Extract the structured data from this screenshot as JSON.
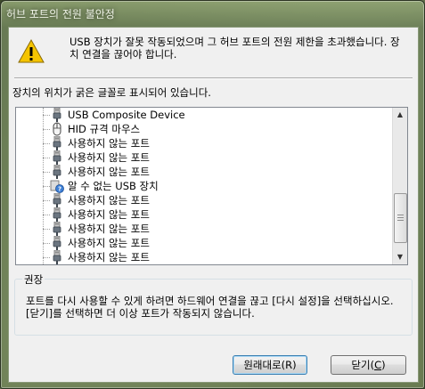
{
  "window": {
    "title": "허브 포트의 전원 불안정"
  },
  "message": {
    "icon": "warning-icon",
    "text": "USB 장치가 잘못 작동되었으며 그 허브 포트의 전원 제한을 초과했습니다. 장치 연결을 끊어야 합니다."
  },
  "location_label": "장치의 위치가 굵은 글꼴로 표시되어 있습니다.",
  "tree": {
    "items": [
      {
        "label": "USB Composite Device",
        "icon": "usb-plug-icon"
      },
      {
        "label": "HID 규격 마우스",
        "icon": "mouse-icon"
      },
      {
        "label": "사용하지 않는 포트",
        "icon": "usb-plug-icon"
      },
      {
        "label": "사용하지 않는 포트",
        "icon": "usb-plug-icon"
      },
      {
        "label": "사용하지 않는 포트",
        "icon": "usb-plug-icon"
      },
      {
        "label": "알 수 없는 USB 장치",
        "icon": "unknown-device-icon"
      },
      {
        "label": "사용하지 않는 포트",
        "icon": "usb-plug-icon"
      },
      {
        "label": "사용하지 않는 포트",
        "icon": "usb-plug-icon"
      },
      {
        "label": "사용하지 않는 포트",
        "icon": "usb-plug-icon"
      },
      {
        "label": "사용하지 않는 포트",
        "icon": "usb-plug-icon"
      },
      {
        "label": "사용하지 않는 포트",
        "icon": "usb-plug-icon"
      }
    ]
  },
  "recommendation": {
    "title": "권장",
    "text": "포트를 다시 사용할 수 있게 하려면 하드웨어 연결을 끊고 [다시 설정]을 선택하십시오. [닫기]를 선택하면 더 이상 포트가 작동되지 않습니다."
  },
  "buttons": {
    "reset_label": "원래대로(R)",
    "close_prefix": "닫기(",
    "close_key": "C",
    "close_suffix": ")"
  }
}
